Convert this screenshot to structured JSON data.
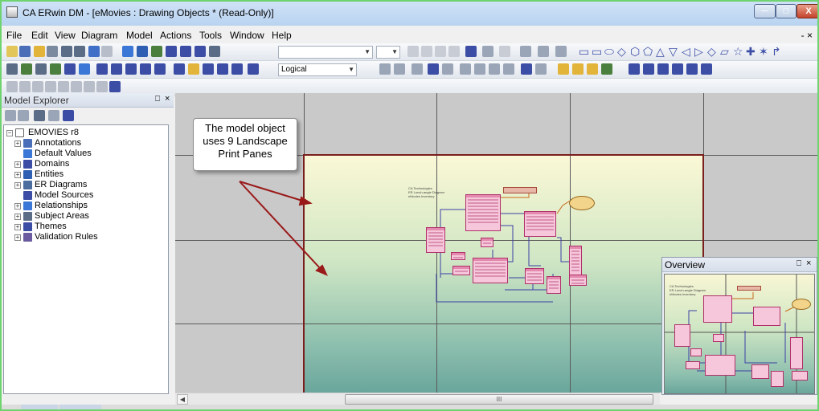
{
  "window": {
    "title": "CA ERwin DM - [eMovies : Drawing Objects * (Read-Only)]"
  },
  "menu": {
    "items": [
      "File",
      "Edit",
      "View",
      "Diagram",
      "Model",
      "Actions",
      "Tools",
      "Window",
      "Help"
    ],
    "mdi_close": "- ×"
  },
  "toolbar": {
    "view_mode": "Logical"
  },
  "model_explorer": {
    "title": "Model Explorer",
    "pin": "⎕",
    "close": "×",
    "root": "EMOVIES r8",
    "items": [
      {
        "label": "Annotations",
        "icon": "annotations-icon",
        "expandable": true
      },
      {
        "label": "Default Values",
        "icon": "default-values-icon",
        "expandable": false
      },
      {
        "label": "Domains",
        "icon": "domains-icon",
        "expandable": true
      },
      {
        "label": "Entities",
        "icon": "entities-icon",
        "expandable": true
      },
      {
        "label": "ER Diagrams",
        "icon": "er-diagrams-icon",
        "expandable": true
      },
      {
        "label": "Model Sources",
        "icon": "model-sources-icon",
        "expandable": false
      },
      {
        "label": "Relationships",
        "icon": "relationships-icon",
        "expandable": true
      },
      {
        "label": "Subject Areas",
        "icon": "subject-areas-icon",
        "expandable": true
      },
      {
        "label": "Themes",
        "icon": "themes-icon",
        "expandable": true
      },
      {
        "label": "Validation Rules",
        "icon": "validation-rules-icon",
        "expandable": true
      }
    ]
  },
  "canvas": {
    "callout_lines": [
      "The model object",
      "uses 9 Landscape",
      "Print Panes"
    ],
    "diagram_text": [
      "CA Technologies",
      "ER Lunch-angle Diagram",
      "eMovies Inventory"
    ]
  },
  "overview": {
    "title": "Overview",
    "pin": "⎕",
    "close": "×",
    "diagram_text": [
      "CA Technologies",
      "ER Lunch-angle Diagram",
      "eMovies Inventory"
    ]
  },
  "scrollbar": {
    "left_arrow": "◀",
    "thumb_grip": "III"
  },
  "colors": {
    "accent": "#3c4da6",
    "entity_fill": "#f6c7da",
    "entity_border": "#b0306a",
    "arrow": "#b01e1e",
    "page_border": "#7a1e1e"
  }
}
